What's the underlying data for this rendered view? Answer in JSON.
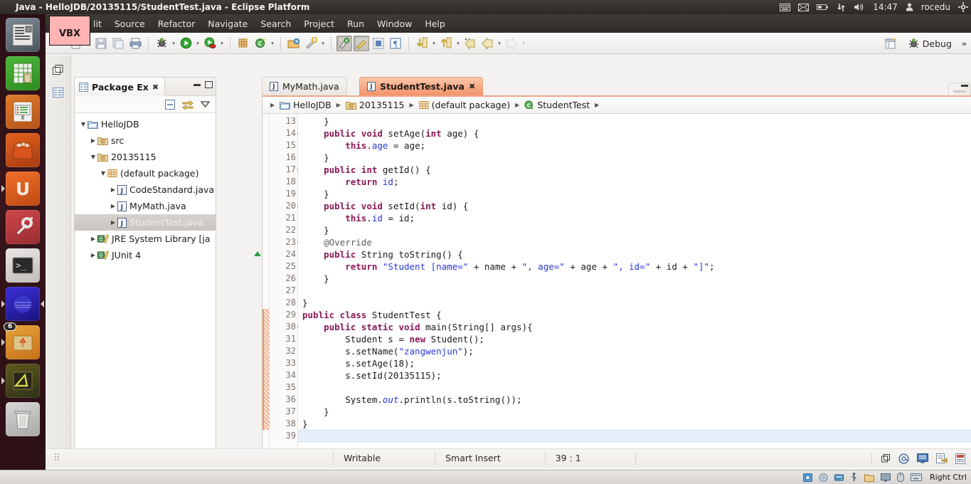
{
  "window": {
    "title": "Java - HelloJDB/20135115/StudentTest.java - Eclipse Platform",
    "overlay_badge": "VBX"
  },
  "tray": {
    "icons": [
      "keyboard-icon",
      "mail-icon",
      "battery-icon",
      "network-icon",
      "volume-icon"
    ],
    "clock": "14:47",
    "user": "rocedu",
    "session_icon": "gear-icon"
  },
  "launcher": {
    "items": [
      {
        "name": "libreoffice-writer",
        "glyph": "☰"
      },
      {
        "name": "libreoffice-calc",
        "glyph": "⊞"
      },
      {
        "name": "libreoffice-impress",
        "glyph": "▦"
      },
      {
        "name": "ubuntu-software-center",
        "glyph": "ὬD"
      },
      {
        "name": "ubuntu-one",
        "glyph": "U"
      },
      {
        "name": "system-settings",
        "glyph": "⚙"
      },
      {
        "name": "terminal",
        "glyph": ">_"
      },
      {
        "name": "firefox",
        "glyph": "●"
      },
      {
        "name": "files",
        "glyph": "↑",
        "badge": "6"
      },
      {
        "name": "eclipse",
        "glyph": "◢"
      },
      {
        "name": "trash",
        "glyph": "Ὕ1"
      }
    ]
  },
  "menu": {
    "items": [
      "lit",
      "Source",
      "Refactor",
      "Navigate",
      "Search",
      "Project",
      "Run",
      "Window",
      "Help"
    ]
  },
  "toolbar": {
    "groups": [
      {
        "items": [
          {
            "name": "new-wizard-icon",
            "caret": true
          },
          {
            "name": "save-icon",
            "caret": false
          },
          {
            "name": "save-all-icon",
            "caret": false
          },
          {
            "name": "print-icon",
            "caret": false
          }
        ]
      },
      {
        "items": [
          {
            "name": "debug-icon",
            "caret": true
          },
          {
            "name": "run-icon",
            "caret": true
          },
          {
            "name": "coverage-icon",
            "caret": true
          }
        ]
      },
      {
        "items": [
          {
            "name": "new-package-icon",
            "caret": false
          },
          {
            "name": "new-class-icon",
            "caret": true
          }
        ]
      },
      {
        "items": [
          {
            "name": "open-type-icon",
            "caret": false
          },
          {
            "name": "external-tools-icon",
            "caret": true
          }
        ]
      },
      {
        "items": [
          {
            "name": "toggle-mark-occurrences-icon",
            "caret": false,
            "pressed": true
          },
          {
            "name": "toggle-block-selection-icon",
            "caret": false,
            "pressed": true
          },
          {
            "name": "show-whitespace-icon",
            "caret": false
          },
          {
            "name": "pilcrow-icon",
            "caret": false
          }
        ]
      },
      {
        "items": [
          {
            "name": "next-annotation-icon",
            "caret": true
          },
          {
            "name": "previous-annotation-icon",
            "caret": true
          },
          {
            "name": "last-edit-location-icon",
            "caret": false
          },
          {
            "name": "back-icon",
            "caret": true
          },
          {
            "name": "forward-icon",
            "caret": true
          }
        ]
      }
    ]
  },
  "perspective": {
    "open_perspective_icon": "open-perspective-icon",
    "current_icon": "debug-perspective-icon",
    "current_label": "Debug",
    "overflow": "»"
  },
  "left_rail": {
    "items": [
      "restore-view-icon",
      "package-explorer-fastview-icon"
    ]
  },
  "right_rail": {
    "items": [
      "restore-icon",
      "outline-view-icon",
      "debug-view-icon",
      "breakpoints-view-icon"
    ]
  },
  "package_explorer": {
    "tab_icon": "package-explorer-icon",
    "tab_label": "Package Ex",
    "tab_close": "✖",
    "toolbar": [
      {
        "name": "collapse-all-icon"
      },
      {
        "name": "link-with-editor-icon"
      },
      {
        "name": "view-menu-icon"
      }
    ],
    "tree": [
      {
        "indent": 0,
        "twisty": "▼",
        "icon": "project-icon",
        "label": "HelloJDB",
        "selected": false
      },
      {
        "indent": 1,
        "twisty": "▶",
        "icon": "source-folder-icon",
        "label": "src",
        "selected": false
      },
      {
        "indent": 1,
        "twisty": "▼",
        "icon": "source-folder-icon",
        "label": "20135115",
        "selected": false
      },
      {
        "indent": 2,
        "twisty": "▼",
        "icon": "package-icon",
        "label": "(default package)",
        "selected": false
      },
      {
        "indent": 3,
        "twisty": "▶",
        "icon": "java-file-icon",
        "label": "CodeStandard.java",
        "selected": false
      },
      {
        "indent": 3,
        "twisty": "▶",
        "icon": "java-file-icon",
        "label": "MyMath.java",
        "selected": false
      },
      {
        "indent": 3,
        "twisty": "▶",
        "icon": "java-file-icon",
        "label": "StudentTest.java",
        "selected": true
      },
      {
        "indent": 1,
        "twisty": "▶",
        "icon": "library-icon",
        "label": "JRE System Library [ja",
        "selected": false
      },
      {
        "indent": 1,
        "twisty": "▶",
        "icon": "library-icon",
        "label": "JUnit 4",
        "selected": false
      }
    ]
  },
  "editor": {
    "tabs": [
      {
        "label": "MyMath.java",
        "active": false,
        "closable": false
      },
      {
        "label": "StudentTest.java",
        "active": true,
        "closable": true
      }
    ],
    "breadcrumb": [
      {
        "icon": "project-icon",
        "label": "HelloJDB"
      },
      {
        "icon": "source-folder-icon",
        "label": "20135115"
      },
      {
        "icon": "package-icon",
        "label": "(default package)"
      },
      {
        "icon": "class-icon",
        "label": "StudentTest"
      }
    ],
    "first_line": 13,
    "lines": [
      {
        "n": 13,
        "fold": false,
        "marker": "none",
        "current": false,
        "tokens": [
          {
            "t": "    }",
            "c": "plain"
          }
        ]
      },
      {
        "n": 14,
        "fold": true,
        "marker": "none",
        "current": false,
        "tokens": [
          {
            "t": "    ",
            "c": "plain"
          },
          {
            "t": "public void",
            "c": "kw"
          },
          {
            "t": " setAge(",
            "c": "plain"
          },
          {
            "t": "int",
            "c": "kw"
          },
          {
            "t": " age) {",
            "c": "plain"
          }
        ]
      },
      {
        "n": 15,
        "fold": false,
        "marker": "none",
        "current": false,
        "tokens": [
          {
            "t": "        ",
            "c": "plain"
          },
          {
            "t": "this",
            "c": "kw"
          },
          {
            "t": ".",
            "c": "plain"
          },
          {
            "t": "age",
            "c": "fld"
          },
          {
            "t": " = age;",
            "c": "plain"
          }
        ]
      },
      {
        "n": 16,
        "fold": false,
        "marker": "none",
        "current": false,
        "tokens": [
          {
            "t": "    }",
            "c": "plain"
          }
        ]
      },
      {
        "n": 17,
        "fold": true,
        "marker": "none",
        "current": false,
        "tokens": [
          {
            "t": "    ",
            "c": "plain"
          },
          {
            "t": "public int",
            "c": "kw"
          },
          {
            "t": " getId() {",
            "c": "plain"
          }
        ]
      },
      {
        "n": 18,
        "fold": false,
        "marker": "none",
        "current": false,
        "tokens": [
          {
            "t": "        ",
            "c": "plain"
          },
          {
            "t": "return",
            "c": "kw"
          },
          {
            "t": " ",
            "c": "plain"
          },
          {
            "t": "id",
            "c": "fld"
          },
          {
            "t": ";",
            "c": "plain"
          }
        ]
      },
      {
        "n": 19,
        "fold": false,
        "marker": "none",
        "current": false,
        "tokens": [
          {
            "t": "    }",
            "c": "plain"
          }
        ]
      },
      {
        "n": 20,
        "fold": true,
        "marker": "none",
        "current": false,
        "tokens": [
          {
            "t": "    ",
            "c": "plain"
          },
          {
            "t": "public void",
            "c": "kw"
          },
          {
            "t": " setId(",
            "c": "plain"
          },
          {
            "t": "int",
            "c": "kw"
          },
          {
            "t": " id) {",
            "c": "plain"
          }
        ]
      },
      {
        "n": 21,
        "fold": false,
        "marker": "none",
        "current": false,
        "tokens": [
          {
            "t": "        ",
            "c": "plain"
          },
          {
            "t": "this",
            "c": "kw"
          },
          {
            "t": ".",
            "c": "plain"
          },
          {
            "t": "id",
            "c": "fld"
          },
          {
            "t": " = id;",
            "c": "plain"
          }
        ]
      },
      {
        "n": 22,
        "fold": false,
        "marker": "none",
        "current": false,
        "tokens": [
          {
            "t": "    }",
            "c": "plain"
          }
        ]
      },
      {
        "n": 23,
        "fold": true,
        "marker": "none",
        "current": false,
        "tokens": [
          {
            "t": "    ",
            "c": "plain"
          },
          {
            "t": "@Override",
            "c": "ann"
          }
        ]
      },
      {
        "n": 24,
        "fold": false,
        "marker": "overrides",
        "current": false,
        "tokens": [
          {
            "t": "    ",
            "c": "plain"
          },
          {
            "t": "public",
            "c": "kw"
          },
          {
            "t": " String toString() {",
            "c": "plain"
          }
        ]
      },
      {
        "n": 25,
        "fold": false,
        "marker": "none",
        "current": false,
        "tokens": [
          {
            "t": "        ",
            "c": "plain"
          },
          {
            "t": "return",
            "c": "kw"
          },
          {
            "t": " ",
            "c": "plain"
          },
          {
            "t": "\"Student [name=\"",
            "c": "st"
          },
          {
            "t": " + name + ",
            "c": "plain"
          },
          {
            "t": "\", age=\"",
            "c": "st"
          },
          {
            "t": " + age + ",
            "c": "plain"
          },
          {
            "t": "\", id=\"",
            "c": "st"
          },
          {
            "t": " + id + ",
            "c": "plain"
          },
          {
            "t": "\"]\"",
            "c": "st"
          },
          {
            "t": ";",
            "c": "plain"
          }
        ]
      },
      {
        "n": 26,
        "fold": false,
        "marker": "none",
        "current": false,
        "tokens": [
          {
            "t": "    }",
            "c": "plain"
          }
        ]
      },
      {
        "n": 27,
        "fold": false,
        "marker": "none",
        "current": false,
        "tokens": [
          {
            "t": "",
            "c": "plain"
          }
        ]
      },
      {
        "n": 28,
        "fold": false,
        "marker": "none",
        "current": false,
        "tokens": [
          {
            "t": "}",
            "c": "plain"
          }
        ]
      },
      {
        "n": 29,
        "fold": false,
        "marker": "changed",
        "current": false,
        "tokens": [
          {
            "t": "public class",
            "c": "kw"
          },
          {
            "t": " StudentTest {",
            "c": "plain"
          }
        ]
      },
      {
        "n": 30,
        "fold": true,
        "marker": "changed",
        "current": false,
        "tokens": [
          {
            "t": "    ",
            "c": "plain"
          },
          {
            "t": "public static void",
            "c": "kw"
          },
          {
            "t": " main(String[] args){",
            "c": "plain"
          }
        ]
      },
      {
        "n": 31,
        "fold": false,
        "marker": "changed",
        "current": false,
        "tokens": [
          {
            "t": "        Student s = ",
            "c": "plain"
          },
          {
            "t": "new",
            "c": "kw"
          },
          {
            "t": " Student();",
            "c": "plain"
          }
        ]
      },
      {
        "n": 32,
        "fold": false,
        "marker": "changed",
        "current": false,
        "tokens": [
          {
            "t": "        s.setName(",
            "c": "plain"
          },
          {
            "t": "\"zangwenjun\"",
            "c": "st"
          },
          {
            "t": ");",
            "c": "plain"
          }
        ]
      },
      {
        "n": 33,
        "fold": false,
        "marker": "changed",
        "current": false,
        "tokens": [
          {
            "t": "        s.setAge(18);",
            "c": "plain"
          }
        ]
      },
      {
        "n": 34,
        "fold": false,
        "marker": "changed",
        "current": false,
        "tokens": [
          {
            "t": "        s.setId(20135115);",
            "c": "plain"
          }
        ]
      },
      {
        "n": 35,
        "fold": false,
        "marker": "changed",
        "current": false,
        "tokens": [
          {
            "t": "",
            "c": "plain"
          }
        ]
      },
      {
        "n": 36,
        "fold": false,
        "marker": "changed",
        "current": false,
        "tokens": [
          {
            "t": "        System.",
            "c": "plain"
          },
          {
            "t": "out",
            "c": "itl"
          },
          {
            "t": ".println(s.toString());",
            "c": "plain"
          }
        ]
      },
      {
        "n": 37,
        "fold": false,
        "marker": "changed",
        "current": false,
        "tokens": [
          {
            "t": "    }",
            "c": "plain"
          }
        ]
      },
      {
        "n": 38,
        "fold": false,
        "marker": "changed",
        "current": false,
        "tokens": [
          {
            "t": "}",
            "c": "plain"
          }
        ]
      },
      {
        "n": 39,
        "fold": false,
        "marker": "none",
        "current": true,
        "tokens": [
          {
            "t": "",
            "c": "plain"
          }
        ]
      }
    ]
  },
  "status_bar": {
    "writable": "Writable",
    "insert_mode": "Smart Insert",
    "cursor_position": "39 : 1",
    "right_icons": [
      "restore-icon",
      "at-icon",
      "console-icon",
      "task-icon",
      "problems-icon"
    ]
  },
  "vbox_bar": {
    "icons": [
      "hdd-icon",
      "cd-icon",
      "network-icon",
      "usb-icon",
      "shared-folder-icon",
      "display-icon",
      "mouse-icon",
      "keyboard-icon"
    ],
    "host_key": "Right Ctrl"
  },
  "colors": {
    "accent_tab": "#f4926a",
    "keyword": "#8a1a56",
    "string": "#2a35d8",
    "panel_bg": "#f3f2f1",
    "current_line": "#e7f0fa",
    "changed_marker": "#f0b694"
  }
}
